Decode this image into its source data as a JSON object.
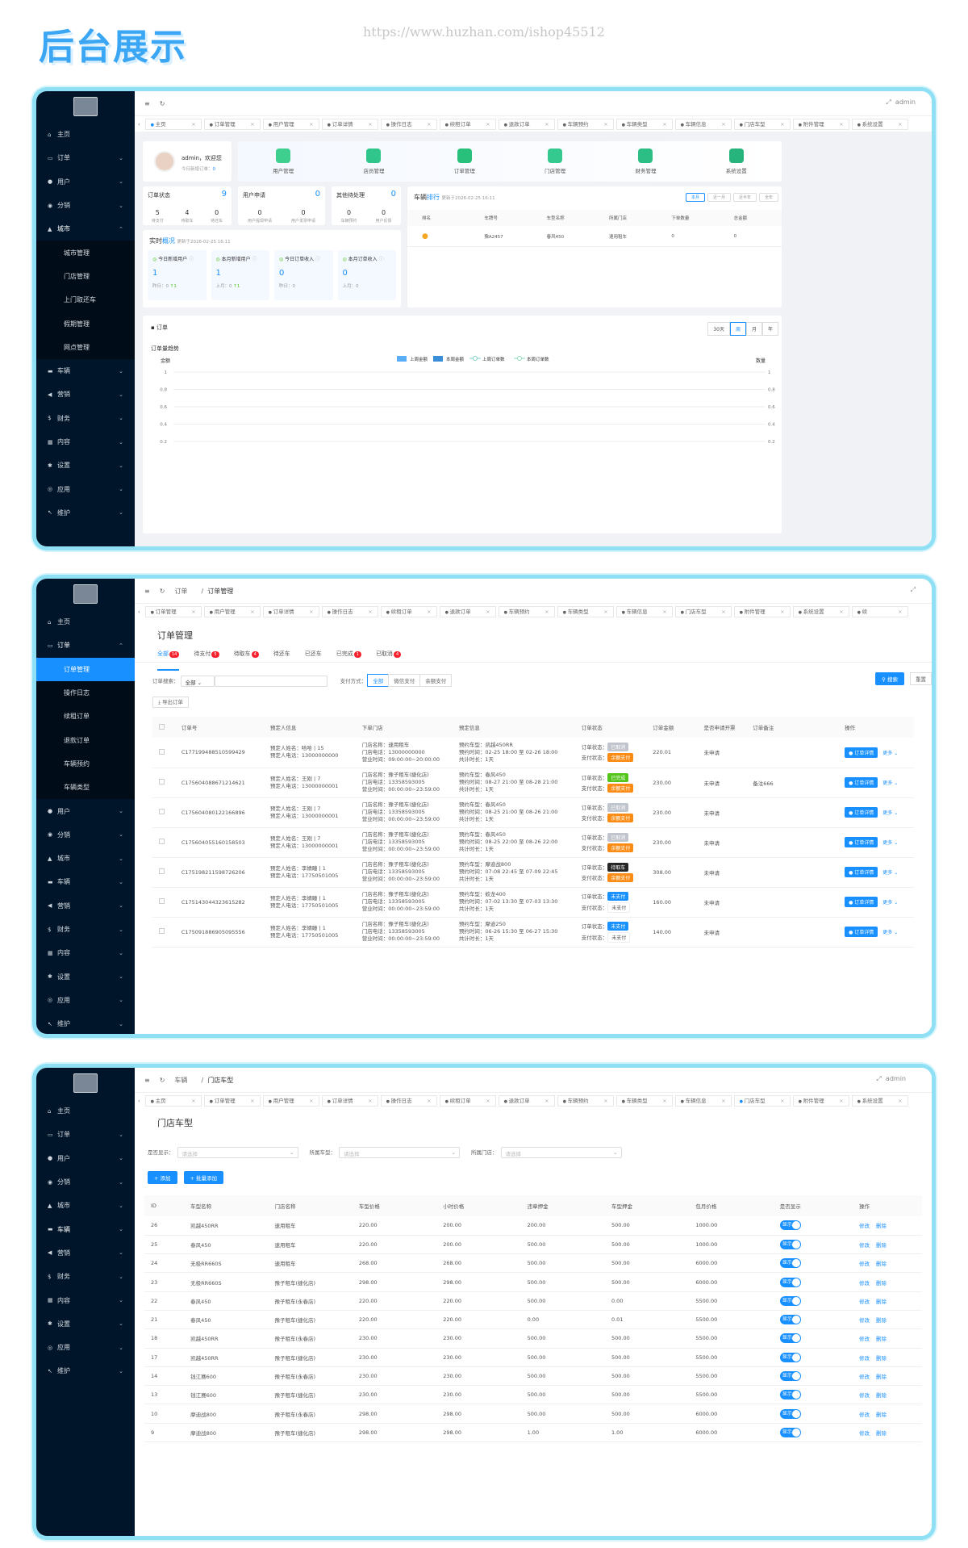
{
  "header": {
    "title": "后台展示",
    "url": "https://www.huzhan.com/ishop45512"
  },
  "menu": {
    "home": "主页",
    "order": "订单",
    "user": "用户",
    "dist": "分销",
    "city": "城市",
    "car": "车辆",
    "market": "营销",
    "finance": "财务",
    "content": "内容",
    "settings": "设置",
    "apps": "应用",
    "maint": "维护",
    "city_sub": [
      "城市管理",
      "门店管理",
      "上门取还车",
      "假期管理",
      "网点管理"
    ],
    "order_sub": [
      "订单管理",
      "操作日志",
      "续租订单",
      "退款订单",
      "车辆预约",
      "车辆类型"
    ]
  },
  "tabs1": [
    "主页",
    "订单管理",
    "用户管理",
    "订单详情",
    "操作日志",
    "续租订单",
    "退款订单",
    "车辆预约",
    "车辆类型",
    "车辆信息",
    "门店车型",
    "附件管理",
    "系统设置"
  ],
  "tabs2": [
    "订单管理",
    "用户管理",
    "订单详情",
    "操作日志",
    "续租订单",
    "退款订单",
    "车辆预约",
    "车辆类型",
    "车辆信息",
    "门店车型",
    "附件管理",
    "系统设置",
    "续"
  ],
  "tabs3": [
    "主页",
    "订单管理",
    "用户管理",
    "订单详情",
    "操作日志",
    "续租订单",
    "退款订单",
    "车辆预约",
    "车辆类型",
    "车辆信息",
    "门店车型",
    "附件管理",
    "系统设置"
  ],
  "s1": {
    "admin_name": "admin",
    "welcome": "admin，欢迎您",
    "today_orders": "今日新增订单：",
    "today_orders_val": "0",
    "quick": [
      "用户管理",
      "店员管理",
      "订单管理",
      "门店管理",
      "财务管理",
      "系统设置"
    ],
    "order_status": {
      "title": "订单状态",
      "count": "9",
      "items": [
        [
          "5",
          "待支付"
        ],
        [
          "4",
          "待取车"
        ],
        [
          "0",
          "待还车"
        ]
      ]
    },
    "user_apply": {
      "title": "用户申请",
      "count": "0",
      "items": [
        [
          "0",
          "用户提现申请"
        ],
        [
          "0",
          "用户发票申请"
        ]
      ]
    },
    "other": {
      "title": "其他待处理",
      "count": "0",
      "items": [
        [
          "0",
          "车辆预约"
        ],
        [
          "0",
          "用户反馈"
        ]
      ]
    },
    "realtime": {
      "title": "实时",
      "title2": "概况",
      "updated": "更新于2026-02-25 16:11",
      "cards": [
        [
          "今日新增用户",
          "1",
          "昨日：",
          "0",
          "1"
        ],
        [
          "本月新增用户",
          "1",
          "上月：",
          "0",
          "1"
        ],
        [
          "今日订单收入",
          "0",
          "昨日：",
          "0",
          ""
        ],
        [
          "本月订单收入",
          "0",
          "上月：",
          "0",
          ""
        ]
      ]
    },
    "rank": {
      "title": "车辆",
      "title2": "排行",
      "updated": "更新于2026-02-25 16:11",
      "btns": [
        "本月",
        "近一月",
        "近半年",
        "全年"
      ],
      "cols": [
        "排名",
        "车牌号",
        "车型名称",
        "所属门店",
        "下单数量",
        "总金额"
      ],
      "row": [
        "豫A2457",
        "春风450",
        "速用租车",
        "0",
        "0"
      ]
    },
    "chart": {
      "title": "订单",
      "sub": "订单量趋势",
      "ylabel_l": "金额",
      "ylabel_r": "数量",
      "legend": [
        "上周金额",
        "本周金额",
        "上周订单数",
        "本周订单数"
      ],
      "ranges": [
        "30天",
        "周",
        "月",
        "年"
      ],
      "ticks": [
        "1",
        "0.8",
        "0.6",
        "0.4",
        "0.2"
      ]
    }
  },
  "s2": {
    "breadcrumb": [
      "订单",
      "订单管理"
    ],
    "title": "订单管理",
    "status_tabs": [
      [
        "全部",
        "14"
      ],
      [
        "待支付",
        "5"
      ],
      [
        "待取车",
        "4"
      ],
      [
        "待还车",
        ""
      ],
      [
        "已还车",
        ""
      ],
      [
        "已完成",
        "1"
      ],
      [
        "已取消",
        "4"
      ]
    ],
    "search_label": "订单搜索：",
    "search_select": "全部",
    "pay_label": "支付方式：",
    "pay_opts": [
      "全部",
      "微信支付",
      "余额支付"
    ],
    "search_btn": "搜索",
    "reset_btn": "重置",
    "export_btn": "导出订单",
    "cols": [
      "订单号",
      "预定人信息",
      "下单门店",
      "预定信息",
      "订单状态",
      "订单金额",
      "是否申请开票",
      "订单备注",
      "操作"
    ],
    "rows": [
      {
        "no": "C177199488510599429",
        "name": "预定人姓名：哈哈 | 15",
        "phone": "预定人电话：13000000000",
        "store": "门店名称：速用租车",
        "sphone": "门店电话：13000000000",
        "hours": "营业时间：09:00:00~20:00:00",
        "car": "预约车型：凯越450RR",
        "time": "预约时间：02-25 18:00 至 02-26 18:00",
        "dur": "共计时长：1天",
        "st1": "已取消",
        "c1": "#c0c4cc",
        "st2": "余额支付",
        "c2": "#fa8c16",
        "amt": "220.01",
        "inv": "未申请",
        "note": ""
      },
      {
        "no": "C175604088671214621",
        "name": "预定人姓名：王刚 | 7",
        "phone": "预定人电话：13000000001",
        "store": "门店名称：豫子租车(捷化店)",
        "sphone": "门店电话：13358593005",
        "hours": "营业时间：00:00:00~23:59:00",
        "car": "预约车型：春风450",
        "time": "预约时间：08-27 21:00 至 08-28 21:00",
        "dur": "共计时长：1天",
        "st1": "已完成",
        "c1": "#52c41a",
        "st2": "余额支付",
        "c2": "#fa8c16",
        "amt": "230.00",
        "inv": "未申请",
        "note": "备注666"
      },
      {
        "no": "C175604080122166896",
        "name": "预定人姓名：王刚 | 7",
        "phone": "预定人电话：13000000001",
        "store": "门店名称：豫子租车(捷化店)",
        "sphone": "门店电话：13358593005",
        "hours": "营业时间：00:00:00~23:59:00",
        "car": "预约车型：春风450",
        "time": "预约时间：08-25 21:00 至 08-26 21:00",
        "dur": "共计时长：1天",
        "st1": "已取消",
        "c1": "#c0c4cc",
        "st2": "余额支付",
        "c2": "#fa8c16",
        "amt": "230.00",
        "inv": "未申请",
        "note": ""
      },
      {
        "no": "C175604055160158503",
        "name": "预定人姓名：王刚 | 7",
        "phone": "预定人电话：13000000001",
        "store": "门店名称：豫子租车(捷化店)",
        "sphone": "门店电话：13358593005",
        "hours": "营业时间：00:00:00~23:59:00",
        "car": "预约车型：春风450",
        "time": "预约时间：08-25 22:00 至 08-26 22:00",
        "dur": "共计时长：1天",
        "st1": "已取消",
        "c1": "#c0c4cc",
        "st2": "余额支付",
        "c2": "#fa8c16",
        "amt": "230.00",
        "inv": "未申请",
        "note": ""
      },
      {
        "no": "C175198211598726206",
        "name": "预定人姓名：李婧瞳 | 1",
        "phone": "预定人电话：17750501005",
        "store": "门店名称：豫子租车(捷化店)",
        "sphone": "门店电话：13358593005",
        "hours": "营业时间：00:00:00~23:59:00",
        "car": "预约车型：摩迪战800",
        "time": "预约时间：07-08 22:45 至 07-09 22:45",
        "dur": "共计时长：1天",
        "st1": "待取车",
        "c1": "#262626",
        "st2": "余额支付",
        "c2": "#fa8c16",
        "amt": "308.00",
        "inv": "未申请",
        "note": ""
      },
      {
        "no": "C175143044323615282",
        "name": "预定人姓名：李婧瞳 | 1",
        "phone": "预定人电话：17750501005",
        "store": "门店名称：豫子租车(捷化店)",
        "sphone": "门店电话：13358593005",
        "hours": "营业时间：00:00:00~23:59:00",
        "car": "预约车型：蛟龙400",
        "time": "预约时间：07-02 13:30 至 07-03 13:30",
        "dur": "共计时长：1天",
        "st1": "未支付",
        "c1": "#1890ff",
        "st2": "未支付",
        "c2": "",
        "amt": "160.00",
        "inv": "未申请",
        "note": ""
      },
      {
        "no": "C175091886905095556",
        "name": "预定人姓名：李婧瞳 | 1",
        "phone": "预定人电话：17750501005",
        "store": "门店名称：豫子租车(捷化店)",
        "sphone": "门店电话：13358593005",
        "hours": "营业时间：00:00:00~23:59:00",
        "car": "预约车型：摩迪250",
        "time": "预约时间：06-26 15:30 至 06-27 15:30",
        "dur": "共计时长：1天",
        "st1": "未支付",
        "c1": "#1890ff",
        "st2": "未支付",
        "c2": "",
        "amt": "140.00",
        "inv": "未申请",
        "note": ""
      }
    ],
    "st_lbl1": "订单状态：",
    "st_lbl2": "支付状态：",
    "detail_btn": "订单详情",
    "more": "更多"
  },
  "s3": {
    "breadcrumb": [
      "车辆",
      "门店车型"
    ],
    "title": "门店车型",
    "filters": [
      [
        "是否显示：",
        "请选择"
      ],
      [
        "所属车型：",
        "请选择"
      ],
      [
        "所属门店：",
        "请选择"
      ]
    ],
    "add": "添加",
    "batch_add": "批量添加",
    "cols": [
      "ID",
      "车型名称",
      "门店名称",
      "车型价格",
      "小时价格",
      "违章押金",
      "车型押金",
      "包月价格",
      "是否显示",
      "操作"
    ],
    "rows": [
      [
        "26",
        "凯越450RR",
        "速用租车",
        "220.00",
        "200.00",
        "200.00",
        "500.00",
        "1000.00"
      ],
      [
        "25",
        "春风450",
        "速用租车",
        "220.00",
        "200.00",
        "500.00",
        "500.00",
        "1000.00"
      ],
      [
        "24",
        "无极RR660S",
        "速用租车",
        "268.00",
        "268.00",
        "500.00",
        "500.00",
        "6000.00"
      ],
      [
        "23",
        "无极RR660S",
        "豫子租车(捷化店)",
        "298.00",
        "298.00",
        "500.00",
        "500.00",
        "6000.00"
      ],
      [
        "22",
        "春风450",
        "豫子租车(永春店)",
        "220.00",
        "220.00",
        "500.00",
        "0.00",
        "5500.00"
      ],
      [
        "21",
        "春风450",
        "豫子租车(捷化店)",
        "220.00",
        "220.00",
        "0.00",
        "0.01",
        "5500.00"
      ],
      [
        "18",
        "凯越450RR",
        "豫子租车(永春店)",
        "230.00",
        "230.00",
        "500.00",
        "500.00",
        "5500.00"
      ],
      [
        "17",
        "凯越450RR",
        "豫子租车(捷化店)",
        "230.00",
        "230.00",
        "500.00",
        "500.00",
        "5500.00"
      ],
      [
        "14",
        "钱江赛600",
        "豫子租车(永春店)",
        "230.00",
        "230.00",
        "500.00",
        "500.00",
        "5500.00"
      ],
      [
        "13",
        "钱江赛600",
        "豫子租车(捷化店)",
        "230.00",
        "230.00",
        "500.00",
        "500.00",
        "5500.00"
      ],
      [
        "10",
        "摩迪战800",
        "豫子租车(永春店)",
        "298.00",
        "298.00",
        "500.00",
        "500.00",
        "6000.00"
      ],
      [
        "9",
        "摩迪战800",
        "豫子租车(捷化店)",
        "298.00",
        "298.00",
        "1.00",
        "1.00",
        "6000.00"
      ]
    ],
    "show": "显示",
    "edit": "修改",
    "del": "删除"
  }
}
